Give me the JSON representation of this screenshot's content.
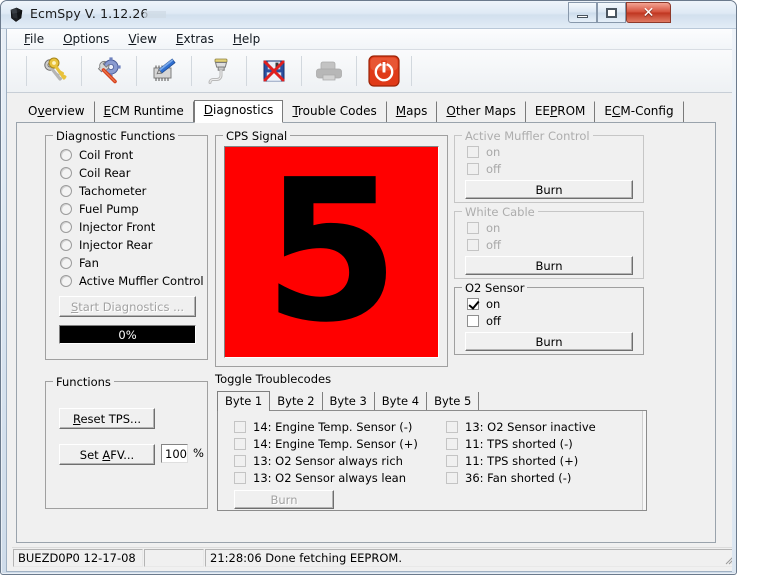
{
  "window": {
    "title": "EcmSpy V. 1.12.26",
    "app_icon": "gem-icon",
    "controls": {
      "minimize": "minimize-icon",
      "maximize": "maximize-icon",
      "close": "close-icon"
    }
  },
  "menubar": {
    "items": [
      {
        "label": "File",
        "accel": "F"
      },
      {
        "label": "Options",
        "accel": "O"
      },
      {
        "label": "View",
        "accel": "V"
      },
      {
        "label": "Extras",
        "accel": "E"
      },
      {
        "label": "Help",
        "accel": "H"
      }
    ]
  },
  "toolbar": {
    "buttons": [
      {
        "icon": "keys-icon",
        "enabled": true
      },
      {
        "icon": "wrench-gear-icon",
        "enabled": true
      },
      {
        "icon": "chip-scan-icon",
        "enabled": true
      },
      {
        "icon": "connector-plug-icon",
        "enabled": true
      },
      {
        "icon": "save-cancel-icon",
        "enabled": true
      },
      {
        "icon": "printer-icon",
        "enabled": false
      },
      {
        "icon": "power-icon",
        "enabled": true,
        "color": "#e03a18"
      }
    ]
  },
  "tabs": {
    "selected": "Diagnostics",
    "items": [
      {
        "label": "Overview",
        "accel": "v"
      },
      {
        "label": "ECM Runtime",
        "accel": "E"
      },
      {
        "label": "Diagnostics",
        "accel": "D"
      },
      {
        "label": "Trouble Codes",
        "accel": "T"
      },
      {
        "label": "Maps",
        "accel": "M"
      },
      {
        "label": "Other Maps",
        "accel": "O"
      },
      {
        "label": "EEPROM",
        "accel": "P"
      },
      {
        "label": "ECM-Config",
        "accel": "C"
      }
    ]
  },
  "diagnostic_functions": {
    "legend": "Diagnostic Functions",
    "options": [
      {
        "label": "Coil Front",
        "checked": false
      },
      {
        "label": "Coil Rear",
        "checked": false
      },
      {
        "label": "Tachometer",
        "checked": false
      },
      {
        "label": "Fuel Pump",
        "checked": false
      },
      {
        "label": "Injector Front",
        "checked": false
      },
      {
        "label": "Injector Rear",
        "checked": false
      },
      {
        "label": "Fan",
        "checked": false
      },
      {
        "label": "Active Muffler Control",
        "checked": false
      }
    ],
    "start_button": {
      "label": "Start Diagnostics ...",
      "accel": "S",
      "enabled": false
    },
    "progress": {
      "value": 0,
      "text": "0%"
    }
  },
  "cps_signal": {
    "legend": "CPS Signal",
    "value": "5",
    "background_color": "#FF0000",
    "digit_color": "#000000"
  },
  "active_muffler_control": {
    "legend": "Active Muffler Control",
    "enabled": false,
    "on": {
      "label": "on",
      "checked": false
    },
    "off": {
      "label": "off",
      "checked": false
    },
    "burn_button": {
      "label": "Burn",
      "enabled": false
    }
  },
  "white_cable": {
    "legend": "White Cable",
    "enabled": false,
    "on": {
      "label": "on",
      "checked": false
    },
    "off": {
      "label": "off",
      "checked": false
    },
    "burn_button": {
      "label": "Burn",
      "enabled": false
    }
  },
  "o2_sensor": {
    "legend": "O2 Sensor",
    "enabled": true,
    "on": {
      "label": "on",
      "checked": true
    },
    "off": {
      "label": "off",
      "checked": false
    },
    "burn_button": {
      "label": "Burn",
      "enabled": true
    }
  },
  "functions": {
    "legend": "Functions",
    "reset_tps": {
      "label": "Reset TPS...",
      "accel": "R"
    },
    "set_afv": {
      "label": "Set AFV...",
      "accel": "A"
    },
    "afv_value": "100",
    "afv_unit": "%"
  },
  "toggle_troublecodes": {
    "label": "Toggle Troublecodes",
    "tabs": [
      {
        "label": "Byte 1"
      },
      {
        "label": "Byte 2"
      },
      {
        "label": "Byte 3"
      },
      {
        "label": "Byte 4"
      },
      {
        "label": "Byte 5"
      }
    ],
    "selected_tab": "Byte 1",
    "left_column": [
      {
        "label": "14: Engine Temp. Sensor (-)",
        "checked": false
      },
      {
        "label": "14: Engine Temp. Sensor (+)",
        "checked": false
      },
      {
        "label": "13: O2 Sensor always rich",
        "checked": false
      },
      {
        "label": "13: O2 Sensor always lean",
        "checked": false
      }
    ],
    "right_column": [
      {
        "label": "13: O2 Sensor inactive",
        "checked": false
      },
      {
        "label": "11: TPS shorted (-)",
        "checked": false
      },
      {
        "label": "11: TPS shorted (+)",
        "checked": false
      },
      {
        "label": "36: Fan shorted (-)",
        "checked": false
      }
    ],
    "burn_button": {
      "label": "Burn",
      "enabled": false
    }
  },
  "statusbar": {
    "ecm_id": "BUEZD0P0 12-17-08",
    "middle": "",
    "message": "21:28:06 Done fetching EEPROM."
  }
}
